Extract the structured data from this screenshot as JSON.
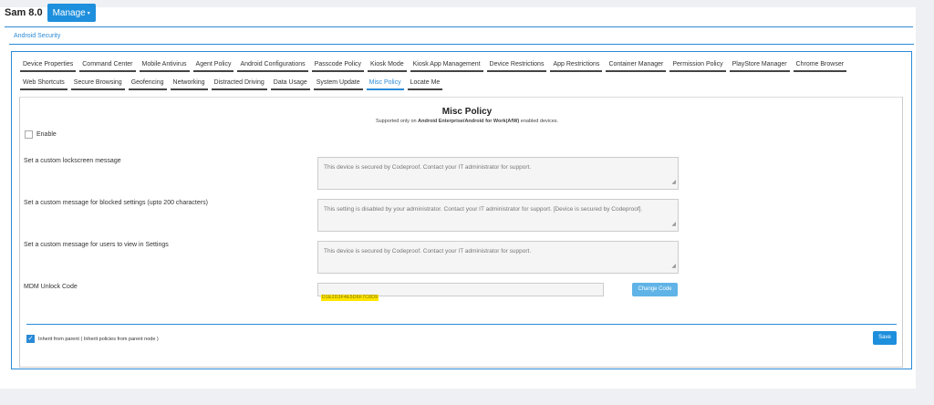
{
  "header": {
    "app_title": "Sam 8.0",
    "manage_label": "Manage",
    "manage_caret": "▾"
  },
  "outer_tab": "Android Security",
  "tabs_row1": [
    "Device Properties",
    "Command Center",
    "Mobile Antivirus",
    "Agent Policy",
    "Android Configurations",
    "Passcode Policy",
    "Kiosk Mode",
    "Kiosk App Management",
    "Device Restrictions",
    "App Restrictions",
    "Container Manager",
    "Permission Policy",
    "PlayStore Manager",
    "Chrome Browser"
  ],
  "tabs_row2": [
    "Web Shortcuts",
    "Secure Browsing",
    "Geofencing",
    "Networking",
    "Distracted Driving",
    "Data Usage",
    "System Update",
    "Misc Policy",
    "Locate Me"
  ],
  "active_tab": "Misc Policy",
  "policy": {
    "title": "Misc Policy",
    "subtitle_prefix": "Supported only on ",
    "subtitle_bold": "Android Enterprise/Android for Work(AfW)",
    "subtitle_suffix": " enabled devices.",
    "enable_label": "Enable",
    "lockscreen_label": "Set a custom lockscreen message",
    "lockscreen_value": "This device is secured by Codeproof. Contact your IT administrator for support.",
    "blocked_label": "Set a custom message for blocked settings (upto 200 characters)",
    "blocked_value": "This setting is disabled by your administrator. Contact your IT administrator for support. [Device is secured by Codeproof].",
    "settings_label": "Set a custom message for users to view in Settings",
    "settings_value": "This device is secured by Codeproof. Contact your IT administrator for support.",
    "mdm_label": "MDM Unlock Code",
    "mdm_code_value": "D1E2D3F4E5D6F7C8D9",
    "change_code_label": "Change Code",
    "inherit_label": "Inherit from parent ( Inherit policies from parent node )",
    "save_label": "Save"
  },
  "colors": {
    "accent": "#2b8ad6",
    "button": "#1e8fdc",
    "highlight": "#ffe600"
  },
  "icons": {
    "manage_caret": "chevron-down-icon",
    "inherit_check": "checkmark-icon",
    "resize": "resize-handle-icon"
  }
}
